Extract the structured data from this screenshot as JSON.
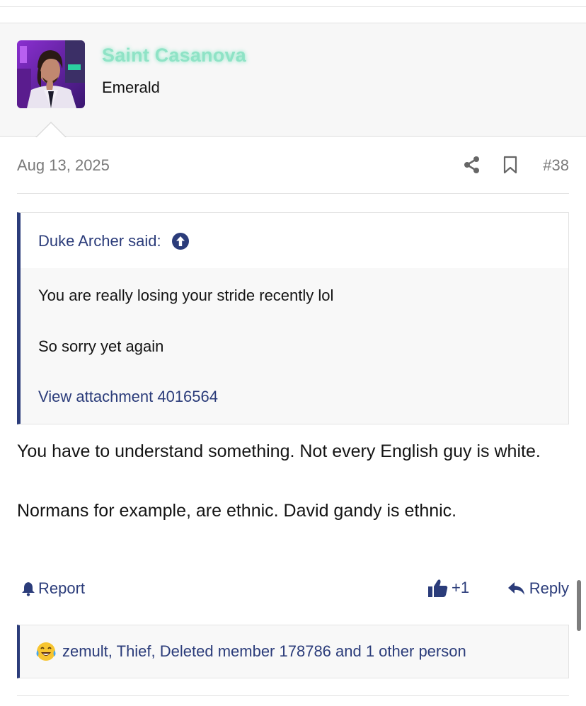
{
  "author": {
    "username": "Saint Casanova",
    "user_title": "Emerald",
    "username_color": "#8fe3c6"
  },
  "meta": {
    "date": "Aug 13, 2025",
    "post_number": "#38",
    "icons": [
      "share-icon",
      "bookmark-icon"
    ]
  },
  "quote": {
    "author_label": "Duke Archer said:",
    "lines": [
      "You are really losing your stride recently lol",
      "So sorry yet again"
    ],
    "attachment_link": "View attachment 4016564"
  },
  "body": {
    "paragraphs": [
      "You have to understand something. Not every English guy is white.",
      "Normans for example, are ethnic. David gandy is ethnic."
    ]
  },
  "actions": {
    "report_label": "Report",
    "like_count": "+1",
    "reply_label": "Reply"
  },
  "reactions": {
    "emoji": "😂",
    "text": "zemult, Thief, Deleted member 178786 and 1 other person"
  },
  "colors": {
    "link": "#2b3c7a",
    "meta_text": "#7a7a7a",
    "block_bg": "#f7f7f7"
  }
}
